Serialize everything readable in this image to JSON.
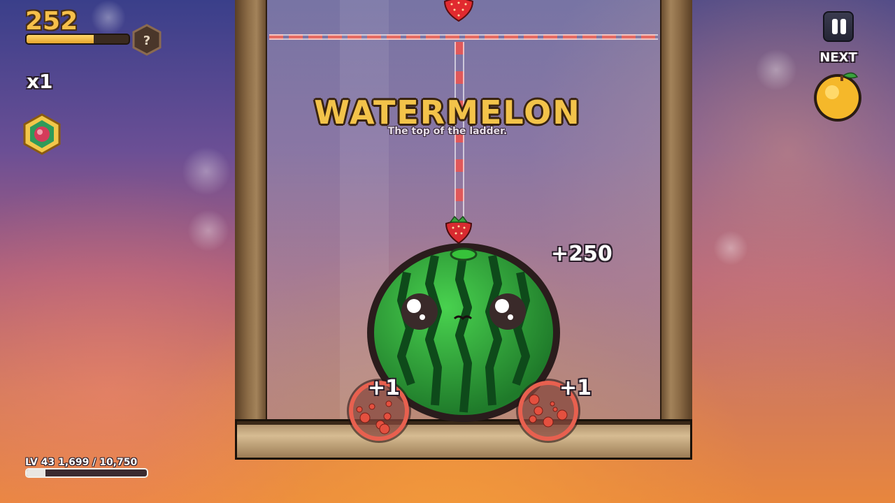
{
  "hud": {
    "score": "252",
    "score_progress": 0.66,
    "help_symbol": "?",
    "multiplier": "x1",
    "powerup_icon": "gem-powerup-icon",
    "level_text": "LV 43   1,699 / 10,750",
    "level_current": 1699,
    "level_target": 10750,
    "next_label": "NEXT",
    "next_fruit": "orange-icon"
  },
  "banner": {
    "title": "WATERMELON",
    "subtitle": "The top of the ladder."
  },
  "popups": {
    "big": "+250",
    "left": "+1",
    "right": "+1"
  },
  "fruits": {
    "dropper": "strawberry",
    "main": "watermelon",
    "bursts": [
      "strawberry-burst",
      "strawberry-burst"
    ]
  },
  "colors": {
    "score_gold": "#f6c04a",
    "title_gold": "#f3c34a",
    "limit_line": "#e56b63",
    "watermelon_green": "#2fa83a"
  }
}
